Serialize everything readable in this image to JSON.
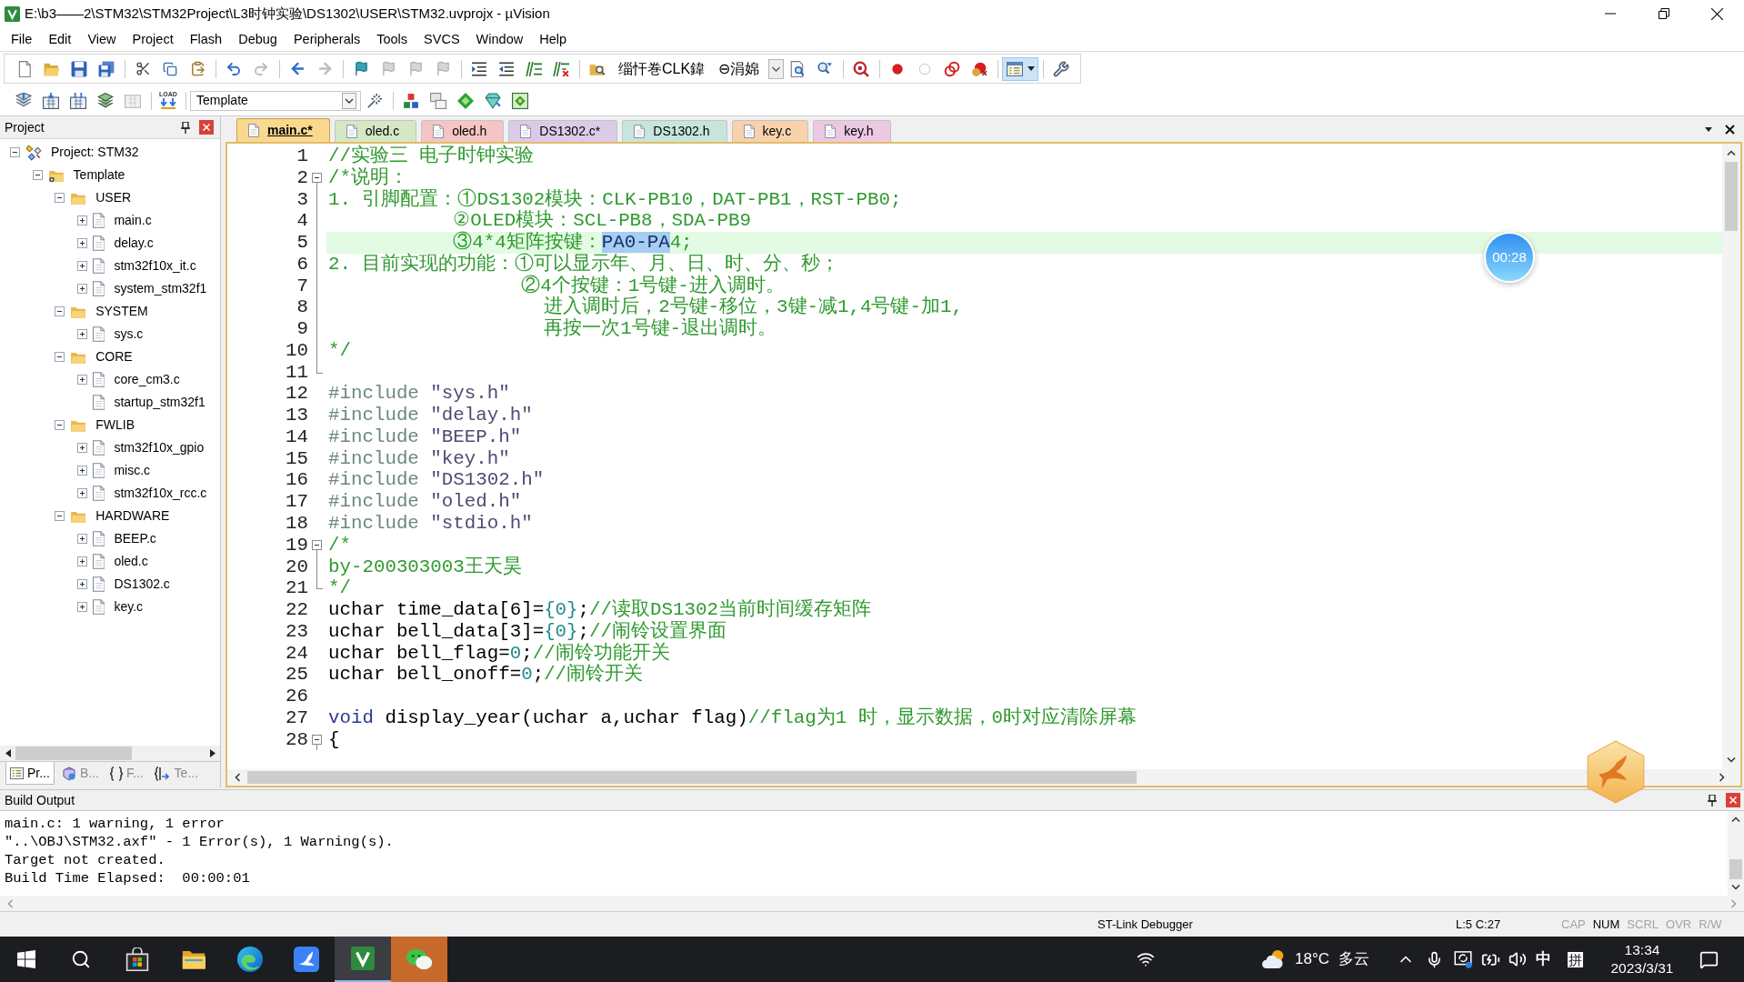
{
  "window": {
    "title": "E:\\b3——2\\STM32\\STM32Project\\L3时钟实验\\DS1302\\USER\\STM32.uvprojx - µVision"
  },
  "menu": [
    "File",
    "Edit",
    "View",
    "Project",
    "Flash",
    "Debug",
    "Peripherals",
    "Tools",
    "SVCS",
    "Window",
    "Help"
  ],
  "toolbar_1": {
    "find_label": "缁忓巻CLK鍏",
    "find_text": "⊖涓婂",
    "layout_pressed": true
  },
  "toolbar_2": {
    "load_label": "LOAD",
    "target": "Template"
  },
  "project_panel": {
    "title": "Project",
    "tree": [
      {
        "label": "Project: STM32",
        "kind": "project",
        "expanded": true,
        "children": [
          {
            "label": "Template",
            "kind": "target",
            "expanded": true,
            "children": [
              {
                "label": "USER",
                "kind": "group",
                "expanded": true,
                "children": [
                  {
                    "label": "main.c",
                    "kind": "file",
                    "expanded": false
                  },
                  {
                    "label": "delay.c",
                    "kind": "file",
                    "expanded": false
                  },
                  {
                    "label": "stm32f10x_it.c",
                    "kind": "file",
                    "expanded": false
                  },
                  {
                    "label": "system_stm32f1",
                    "kind": "file",
                    "expanded": false
                  }
                ]
              },
              {
                "label": "SYSTEM",
                "kind": "group",
                "expanded": true,
                "children": [
                  {
                    "label": "sys.c",
                    "kind": "file",
                    "expanded": false
                  }
                ]
              },
              {
                "label": "CORE",
                "kind": "group",
                "expanded": true,
                "children": [
                  {
                    "label": "core_cm3.c",
                    "kind": "file",
                    "expanded": false
                  },
                  {
                    "label": "startup_stm32f1",
                    "kind": "file"
                  }
                ]
              },
              {
                "label": "FWLIB",
                "kind": "group",
                "expanded": true,
                "children": [
                  {
                    "label": "stm32f10x_gpio",
                    "kind": "file",
                    "expanded": false
                  },
                  {
                    "label": "misc.c",
                    "kind": "file",
                    "expanded": false
                  },
                  {
                    "label": "stm32f10x_rcc.c",
                    "kind": "file",
                    "expanded": false
                  }
                ]
              },
              {
                "label": "HARDWARE",
                "kind": "group",
                "expanded": true,
                "children": [
                  {
                    "label": "BEEP.c",
                    "kind": "file",
                    "expanded": false
                  },
                  {
                    "label": "oled.c",
                    "kind": "file",
                    "expanded": false
                  },
                  {
                    "label": "DS1302.c",
                    "kind": "file",
                    "expanded": false
                  },
                  {
                    "label": "key.c",
                    "kind": "file",
                    "expanded": false
                  }
                ]
              }
            ]
          }
        ]
      }
    ],
    "tabs": [
      {
        "label": "Pr...",
        "kind": "project",
        "selected": true
      },
      {
        "label": "B...",
        "kind": "books",
        "selected": false
      },
      {
        "label": "F...",
        "kind": "functions",
        "selected": false
      },
      {
        "label": "Te...",
        "kind": "templates",
        "selected": false
      }
    ]
  },
  "editor": {
    "tabs": [
      {
        "label": "main.c*",
        "selected": true,
        "color": "#f9d98f"
      },
      {
        "label": "oled.c",
        "selected": false,
        "color": "#d5e8c4"
      },
      {
        "label": "oled.h",
        "selected": false,
        "color": "#f5c4c4"
      },
      {
        "label": "DS1302.c*",
        "selected": false,
        "color": "#dccbe8"
      },
      {
        "label": "DS1302.h",
        "selected": false,
        "color": "#c7e5dc"
      },
      {
        "label": "key.c",
        "selected": false,
        "color": "#f8d2ad"
      },
      {
        "label": "key.h",
        "selected": false,
        "color": "#ecc9e2"
      }
    ],
    "lines": [
      {
        "number": "1",
        "kind": "normal",
        "current": false,
        "segments": [
          {
            "kind": "comment",
            "text": "//实验三 电子时钟实验"
          }
        ]
      },
      {
        "number": "2",
        "kind": "fold_open",
        "current": false,
        "segments": [
          {
            "kind": "comment",
            "text": "/*说明："
          }
        ]
      },
      {
        "number": "3",
        "kind": "fold_line",
        "current": false,
        "segments": [
          {
            "kind": "comment",
            "text": "1. 引脚配置：①DS1302模块：CLK-PB10，DAT-PB1，RST-PB0;"
          }
        ]
      },
      {
        "number": "4",
        "kind": "fold_line",
        "current": false,
        "segments": [
          {
            "kind": "comment",
            "text": "           ②OLED模块：SCL-PB8，SDA-PB9"
          }
        ]
      },
      {
        "number": "5",
        "kind": "fold_line",
        "current": true,
        "segments": [
          {
            "kind": "comment",
            "text": "           ③4*4矩阵按键："
          },
          {
            "kind": "selection",
            "text": "PA0-PA"
          },
          {
            "kind": "comment",
            "text": "4;"
          }
        ]
      },
      {
        "number": "6",
        "kind": "fold_line",
        "current": false,
        "segments": [
          {
            "kind": "comment",
            "text": "2. 目前实现的功能：①可以显示年、月、日、时、分、秒；"
          }
        ]
      },
      {
        "number": "7",
        "kind": "fold_line",
        "current": false,
        "segments": [
          {
            "kind": "comment",
            "text": "                 ②4个按键：1号键-进入调时。"
          }
        ]
      },
      {
        "number": "8",
        "kind": "fold_line",
        "current": false,
        "segments": [
          {
            "kind": "comment",
            "text": "                   进入调时后，2号键-移位，3键-减1,4号键-加1,"
          }
        ]
      },
      {
        "number": "9",
        "kind": "fold_line",
        "current": false,
        "segments": [
          {
            "kind": "comment",
            "text": "                   再按一次1号键-退出调时。"
          }
        ]
      },
      {
        "number": "10",
        "kind": "fold_line",
        "current": false,
        "segments": [
          {
            "kind": "comment",
            "text": "*/"
          }
        ]
      },
      {
        "number": "11",
        "kind": "fold_end",
        "current": false
      },
      {
        "number": "12",
        "kind": "normal",
        "current": false,
        "segments": [
          {
            "kind": "preprocessor",
            "text": "#include "
          },
          {
            "kind": "string",
            "text": "\"sys.h\""
          }
        ]
      },
      {
        "number": "13",
        "kind": "normal",
        "current": false,
        "segments": [
          {
            "kind": "preprocessor",
            "text": "#include "
          },
          {
            "kind": "string",
            "text": "\"delay.h\""
          }
        ]
      },
      {
        "number": "14",
        "kind": "normal",
        "current": false,
        "segments": [
          {
            "kind": "preprocessor",
            "text": "#include "
          },
          {
            "kind": "string",
            "text": "\"BEEP.h\""
          }
        ]
      },
      {
        "number": "15",
        "kind": "normal",
        "current": false,
        "segments": [
          {
            "kind": "preprocessor",
            "text": "#include "
          },
          {
            "kind": "string",
            "text": "\"key.h\""
          }
        ]
      },
      {
        "number": "16",
        "kind": "normal",
        "current": false,
        "segments": [
          {
            "kind": "preprocessor",
            "text": "#include "
          },
          {
            "kind": "string",
            "text": "\"DS1302.h\""
          }
        ]
      },
      {
        "number": "17",
        "kind": "normal",
        "current": false,
        "segments": [
          {
            "kind": "preprocessor",
            "text": "#include "
          },
          {
            "kind": "string",
            "text": "\"oled.h\""
          }
        ]
      },
      {
        "number": "18",
        "kind": "normal",
        "current": false,
        "segments": [
          {
            "kind": "preprocessor",
            "text": "#include "
          },
          {
            "kind": "string",
            "text": "\"stdio.h\""
          }
        ]
      },
      {
        "number": "19",
        "kind": "fold_open",
        "current": false,
        "segments": [
          {
            "kind": "comment",
            "text": "/*"
          }
        ]
      },
      {
        "number": "20",
        "kind": "fold_line",
        "current": false,
        "segments": [
          {
            "kind": "comment",
            "text": "by-200303003王天昊"
          }
        ]
      },
      {
        "number": "21",
        "kind": "fold_end",
        "current": false,
        "segments": [
          {
            "kind": "comment",
            "text": "*/"
          }
        ]
      },
      {
        "number": "22",
        "kind": "normal",
        "current": false,
        "segments": [
          {
            "kind": "plain",
            "text": "uchar time_data[6]="
          },
          {
            "kind": "number",
            "text": "{0}"
          },
          {
            "kind": "plain",
            "text": ";"
          },
          {
            "kind": "comment",
            "text": "//读取DS1302当前时间缓存矩阵"
          }
        ]
      },
      {
        "number": "23",
        "kind": "normal",
        "current": false,
        "segments": [
          {
            "kind": "plain",
            "text": "uchar bell_data[3]="
          },
          {
            "kind": "number",
            "text": "{0}"
          },
          {
            "kind": "plain",
            "text": ";"
          },
          {
            "kind": "comment",
            "text": "//闹铃设置界面"
          }
        ]
      },
      {
        "number": "24",
        "kind": "normal",
        "current": false,
        "segments": [
          {
            "kind": "plain",
            "text": "uchar bell_flag="
          },
          {
            "kind": "number",
            "text": "0"
          },
          {
            "kind": "plain",
            "text": ";"
          },
          {
            "kind": "comment",
            "text": "//闹铃功能开关"
          }
        ]
      },
      {
        "number": "25",
        "kind": "normal",
        "current": false,
        "segments": [
          {
            "kind": "plain",
            "text": "uchar bell_onoff="
          },
          {
            "kind": "number",
            "text": "0"
          },
          {
            "kind": "plain",
            "text": ";"
          },
          {
            "kind": "comment",
            "text": "//闹铃开关"
          }
        ]
      },
      {
        "number": "26",
        "kind": "normal",
        "current": false
      },
      {
        "number": "27",
        "kind": "normal",
        "current": false,
        "segments": [
          {
            "kind": "keyword",
            "text": "void"
          },
          {
            "kind": "plain",
            "text": " display_year(uchar a,uchar flag)"
          },
          {
            "kind": "comment",
            "text": "//flag为1 时，显示数据，0时对应清除屏幕"
          }
        ]
      },
      {
        "number": "28",
        "kind": "fold_open",
        "current": false,
        "segments": [
          {
            "kind": "plain",
            "text": "{"
          }
        ]
      }
    ],
    "timer": "00:28"
  },
  "build_output": {
    "title": "Build Output",
    "lines": [
      "main.c: 1 warning, 1 error",
      "\"..\\OBJ\\STM32.axf\" - 1 Error(s), 1 Warning(s).",
      "Target not created.",
      "Build Time Elapsed:  00:00:01"
    ]
  },
  "status_bar": {
    "debugger": "ST-Link Debugger",
    "position": "L:5 C:27",
    "indicators": [
      {
        "label": "CAP",
        "on": false
      },
      {
        "label": "NUM",
        "on": true
      },
      {
        "label": "SCRL",
        "on": false
      },
      {
        "label": "OVR",
        "on": false
      },
      {
        "label": "R/W",
        "on": false
      }
    ]
  },
  "taskbar": {
    "buttons": [
      {
        "kind": "start",
        "selected": false,
        "flashing": false
      },
      {
        "kind": "search",
        "selected": false,
        "flashing": false
      },
      {
        "kind": "store",
        "selected": false,
        "flashing": false
      },
      {
        "kind": "explorer",
        "selected": false,
        "flashing": false
      },
      {
        "kind": "browser",
        "selected": false,
        "flashing": false
      },
      {
        "kind": "bird",
        "selected": false,
        "flashing": false
      },
      {
        "kind": "keil",
        "selected": true,
        "flashing": false
      },
      {
        "kind": "wechat",
        "selected": false,
        "flashing": true
      }
    ],
    "temperature": "18°C",
    "weather": "多云",
    "input_language": "中",
    "input_mode": "拼",
    "time": "13:34",
    "date": "2023/3/31"
  }
}
